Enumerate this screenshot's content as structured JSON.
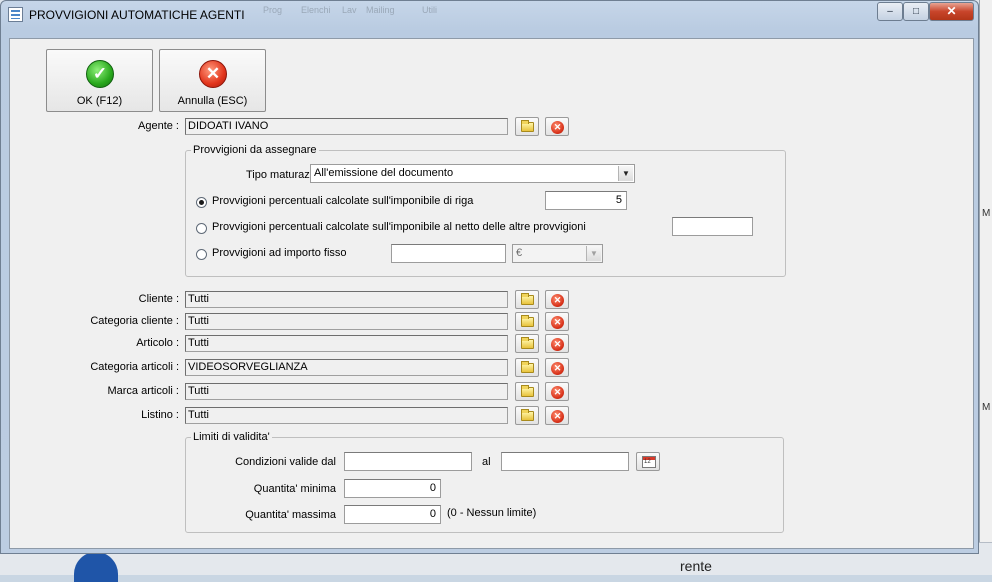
{
  "window": {
    "title": "PROVVIGIONI AUTOMATICHE AGENTI",
    "ghost_menu": [
      "Prog",
      "Elenchi",
      "Lav",
      "Mailing",
      "Utili"
    ],
    "controls": {
      "minimize": "–",
      "maximize": "□",
      "close": "✕"
    }
  },
  "toolbar": {
    "ok_label": "OK (F12)",
    "cancel_label": "Annulla (ESC)"
  },
  "agente": {
    "label": "Agente :",
    "value": "DIDOATI IVANO"
  },
  "provvigioni": {
    "legend": "Provvigioni da assegnare",
    "tipo_label": "Tipo maturazione :",
    "tipo_value": "All'emissione del documento",
    "options": [
      {
        "label": "Provvigioni percentuali calcolate sull'imponibile di riga",
        "selected": true,
        "value": "5"
      },
      {
        "label": "Provvigioni percentuali calcolate sull'imponibile al netto delle altre provvigioni",
        "selected": false,
        "value": ""
      },
      {
        "label": "Provvigioni ad importo fisso",
        "selected": false,
        "value": "",
        "currency": "€"
      }
    ]
  },
  "filters": [
    {
      "label": "Cliente :",
      "value": "Tutti"
    },
    {
      "label": "Categoria cliente :",
      "value": "Tutti"
    },
    {
      "label": "Articolo :",
      "value": "Tutti"
    },
    {
      "label": "Categoria articoli :",
      "value": "VIDEOSORVEGLIANZA"
    },
    {
      "label": "Marca articoli :",
      "value": "Tutti"
    },
    {
      "label": "Listino :",
      "value": "Tutti"
    }
  ],
  "validita": {
    "legend": "Limiti di validita'",
    "dal_label": "Condizioni valide dal",
    "dal_value": "",
    "al_label": "al",
    "al_value": "",
    "min_label": "Quantita' minima",
    "min_value": "0",
    "max_label": "Quantita' massima",
    "max_value": "0",
    "max_note": "(0 - Nessun limite)"
  },
  "background": {
    "right_text": "M",
    "bottom_text": "rente"
  }
}
